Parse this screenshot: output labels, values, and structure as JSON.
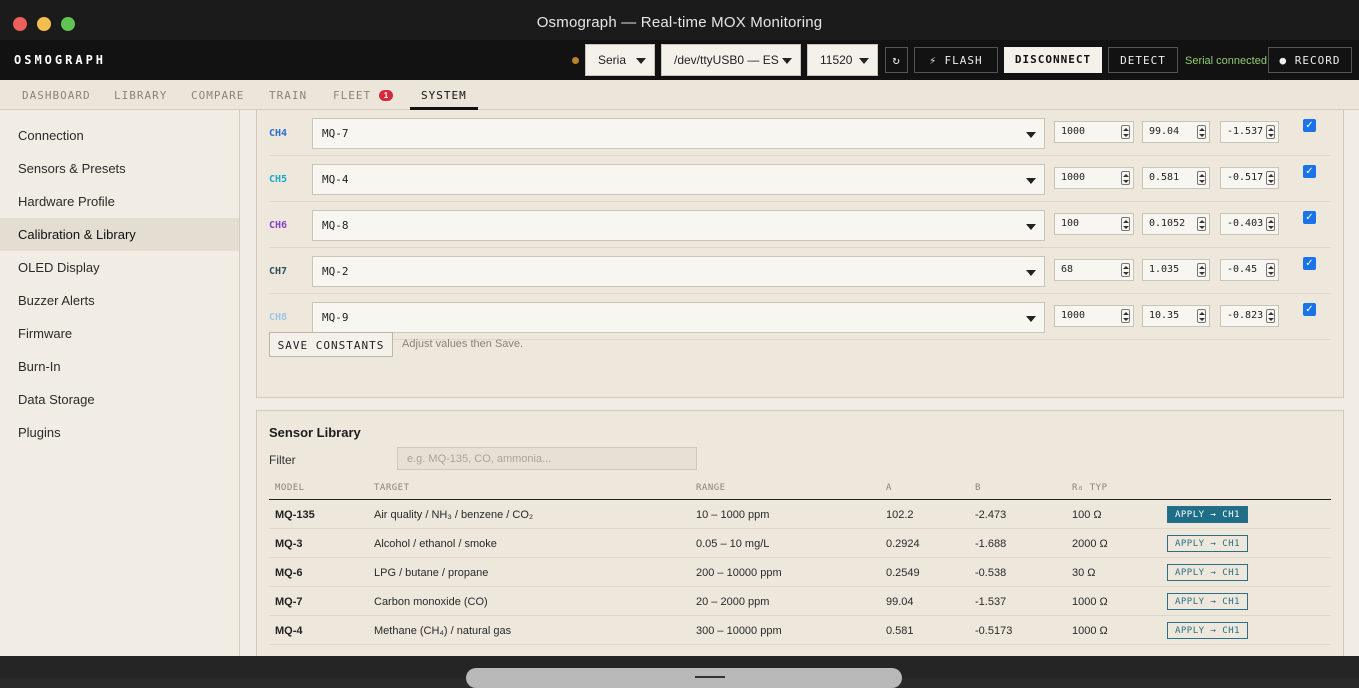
{
  "window": {
    "title": "Osmograph — Real-time MOX Monitoring",
    "traffic_lights": {
      "close": "#ec5f5a",
      "minimize": "#f4bd4f",
      "maximize": "#5fc454"
    }
  },
  "header": {
    "brand": "OSMOGRAPH",
    "transport_select": "Seria",
    "port_select": "/dev/ttyUSB0 — ES",
    "baud_select": "11520",
    "refresh_icon": "refresh-icon",
    "flash_label": "⚡ FLASH",
    "disconnect_label": "DISCONNECT",
    "detect_label": "DETECT",
    "status": "Serial connected",
    "record_label": "● RECORD"
  },
  "tabs": {
    "items": [
      {
        "label": "DASHBOARD"
      },
      {
        "label": "LIBRARY"
      },
      {
        "label": "COMPARE"
      },
      {
        "label": "TRAIN"
      },
      {
        "label": "FLEET"
      },
      {
        "label": "SYSTEM"
      }
    ],
    "active": "SYSTEM",
    "fleet_badge": "1"
  },
  "sidebar": {
    "items": [
      {
        "label": "Connection"
      },
      {
        "label": "Sensors & Presets"
      },
      {
        "label": "Hardware Profile"
      },
      {
        "label": "Calibration & Library"
      },
      {
        "label": "OLED Display"
      },
      {
        "label": "Buzzer Alerts"
      },
      {
        "label": "Firmware"
      },
      {
        "label": "Burn-In"
      },
      {
        "label": "Data Storage"
      },
      {
        "label": "Plugins"
      }
    ],
    "active": "Calibration & Library"
  },
  "calibration": {
    "channels": [
      {
        "label": "CH4",
        "color": "#2a6fd6",
        "model": "MQ-7",
        "rl": "1000",
        "a": "99.04",
        "b": "-1.537",
        "enabled": true
      },
      {
        "label": "CH5",
        "color": "#1aa9c9",
        "model": "MQ-4",
        "rl": "1000",
        "a": "0.581",
        "b": "-0.517",
        "enabled": true
      },
      {
        "label": "CH6",
        "color": "#8a3fd0",
        "model": "MQ-8",
        "rl": "100",
        "a": "0.1052",
        "b": "-0.403",
        "enabled": true
      },
      {
        "label": "CH7",
        "color": "#2f4f5f",
        "model": "MQ-2",
        "rl": "68",
        "a": "1.035",
        "b": "-0.45",
        "enabled": true
      },
      {
        "label": "CH8",
        "color": "#9fc8e8",
        "model": "MQ-9",
        "rl": "1000",
        "a": "10.35",
        "b": "-0.823",
        "enabled": true
      }
    ],
    "save_label": "SAVE CONSTANTS",
    "save_hint": "Adjust values then Save."
  },
  "library": {
    "title": "Sensor Library",
    "filter_label": "Filter",
    "filter_placeholder": "e.g. MQ-135, CO, ammonia...",
    "columns": [
      "MODEL",
      "TARGET",
      "RANGE",
      "A",
      "B",
      "R₀ TYP"
    ],
    "rows": [
      {
        "model": "MQ-135",
        "target": "Air quality / NH₃ / benzene / CO₂",
        "range": "10 – 1000 ppm",
        "a": "102.2",
        "b": "-2.473",
        "r0": "100 Ω",
        "apply": "APPLY → CH1"
      },
      {
        "model": "MQ-3",
        "target": "Alcohol / ethanol / smoke",
        "range": "0.05 – 10 mg/L",
        "a": "0.2924",
        "b": "-1.688",
        "r0": "2000 Ω",
        "apply": "APPLY → CH1"
      },
      {
        "model": "MQ-6",
        "target": "LPG / butane / propane",
        "range": "200 – 10000 ppm",
        "a": "0.2549",
        "b": "-0.538",
        "r0": "30 Ω",
        "apply": "APPLY → CH1"
      },
      {
        "model": "MQ-7",
        "target": "Carbon monoxide (CO)",
        "range": "20 – 2000 ppm",
        "a": "99.04",
        "b": "-1.537",
        "r0": "1000 Ω",
        "apply": "APPLY → CH1"
      },
      {
        "model": "MQ-4",
        "target": "Methane (CH₄) / natural gas",
        "range": "300 – 10000 ppm",
        "a": "0.581",
        "b": "-0.5173",
        "r0": "1000 Ω",
        "apply": "APPLY → CH1"
      }
    ]
  }
}
